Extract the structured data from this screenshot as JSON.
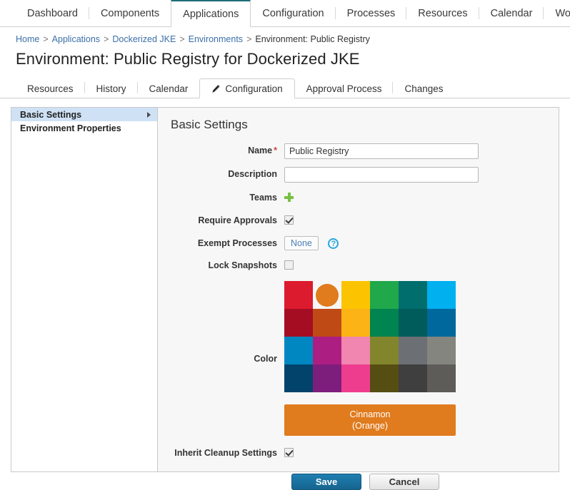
{
  "topnav": {
    "items": [
      {
        "label": "Dashboard",
        "active": false
      },
      {
        "label": "Components",
        "active": false
      },
      {
        "label": "Applications",
        "active": true
      },
      {
        "label": "Configuration",
        "active": false
      },
      {
        "label": "Processes",
        "active": false
      },
      {
        "label": "Resources",
        "active": false
      },
      {
        "label": "Calendar",
        "active": false
      },
      {
        "label": "Work Items",
        "active": false
      }
    ]
  },
  "breadcrumb": {
    "separator": ">",
    "items": [
      {
        "label": "Home",
        "link": true
      },
      {
        "label": "Applications",
        "link": true
      },
      {
        "label": "Dockerized JKE",
        "link": true
      },
      {
        "label": "Environments",
        "link": true
      },
      {
        "label": "Environment: Public Registry",
        "link": false
      }
    ]
  },
  "page": {
    "title": "Environment: Public Registry for Dockerized JKE"
  },
  "subtabs": {
    "items": [
      {
        "label": "Resources",
        "active": false,
        "icon": ""
      },
      {
        "label": "History",
        "active": false,
        "icon": ""
      },
      {
        "label": "Calendar",
        "active": false,
        "icon": ""
      },
      {
        "label": "Configuration",
        "active": true,
        "icon": "pencil-icon"
      },
      {
        "label": "Approval Process",
        "active": false,
        "icon": ""
      },
      {
        "label": "Changes",
        "active": false,
        "icon": ""
      }
    ]
  },
  "sidebar": {
    "items": [
      {
        "label": "Basic Settings",
        "selected": true,
        "arrow": true
      },
      {
        "label": "Environment Properties",
        "selected": false,
        "arrow": false
      }
    ]
  },
  "main": {
    "section_title": "Basic Settings",
    "fields": {
      "name": {
        "label": "Name",
        "required_marker": "*",
        "value": "Public Registry",
        "placeholder": ""
      },
      "description": {
        "label": "Description",
        "value": "",
        "placeholder": ""
      },
      "teams": {
        "label": "Teams",
        "add_icon": "plus-icon"
      },
      "require_approvals": {
        "label": "Require Approvals",
        "checked": true
      },
      "exempt_processes": {
        "label": "Exempt Processes",
        "button_label": "None",
        "help_icon": "help-circle-icon",
        "help_glyph": "?"
      },
      "lock_snapshots": {
        "label": "Lock Snapshots",
        "checked": false
      },
      "color": {
        "label": "Color",
        "selected_index": 1,
        "selected_name_line1": "Cinnamon",
        "selected_name_line2": "(Orange)",
        "selected_hex": "#e07b1e",
        "swatches": [
          "#dd1b2e",
          "#e07b1e",
          "#fcc400",
          "#20a84b",
          "#016e6e",
          "#00b0ef",
          "#a50d23",
          "#c04a16",
          "#fcb316",
          "#008450",
          "#005b5b",
          "#00689d",
          "#0087c1",
          "#ad1e82",
          "#f186b0",
          "#82852c",
          "#6c7074",
          "#85857f",
          "#01436b",
          "#7e1e7c",
          "#ee3d8f",
          "#564d13",
          "#3f3f3f",
          "#5e5c59"
        ]
      },
      "inherit_cleanup_settings": {
        "label": "Inherit Cleanup Settings",
        "checked": true
      }
    },
    "buttons": {
      "save": "Save",
      "cancel": "Cancel"
    }
  }
}
